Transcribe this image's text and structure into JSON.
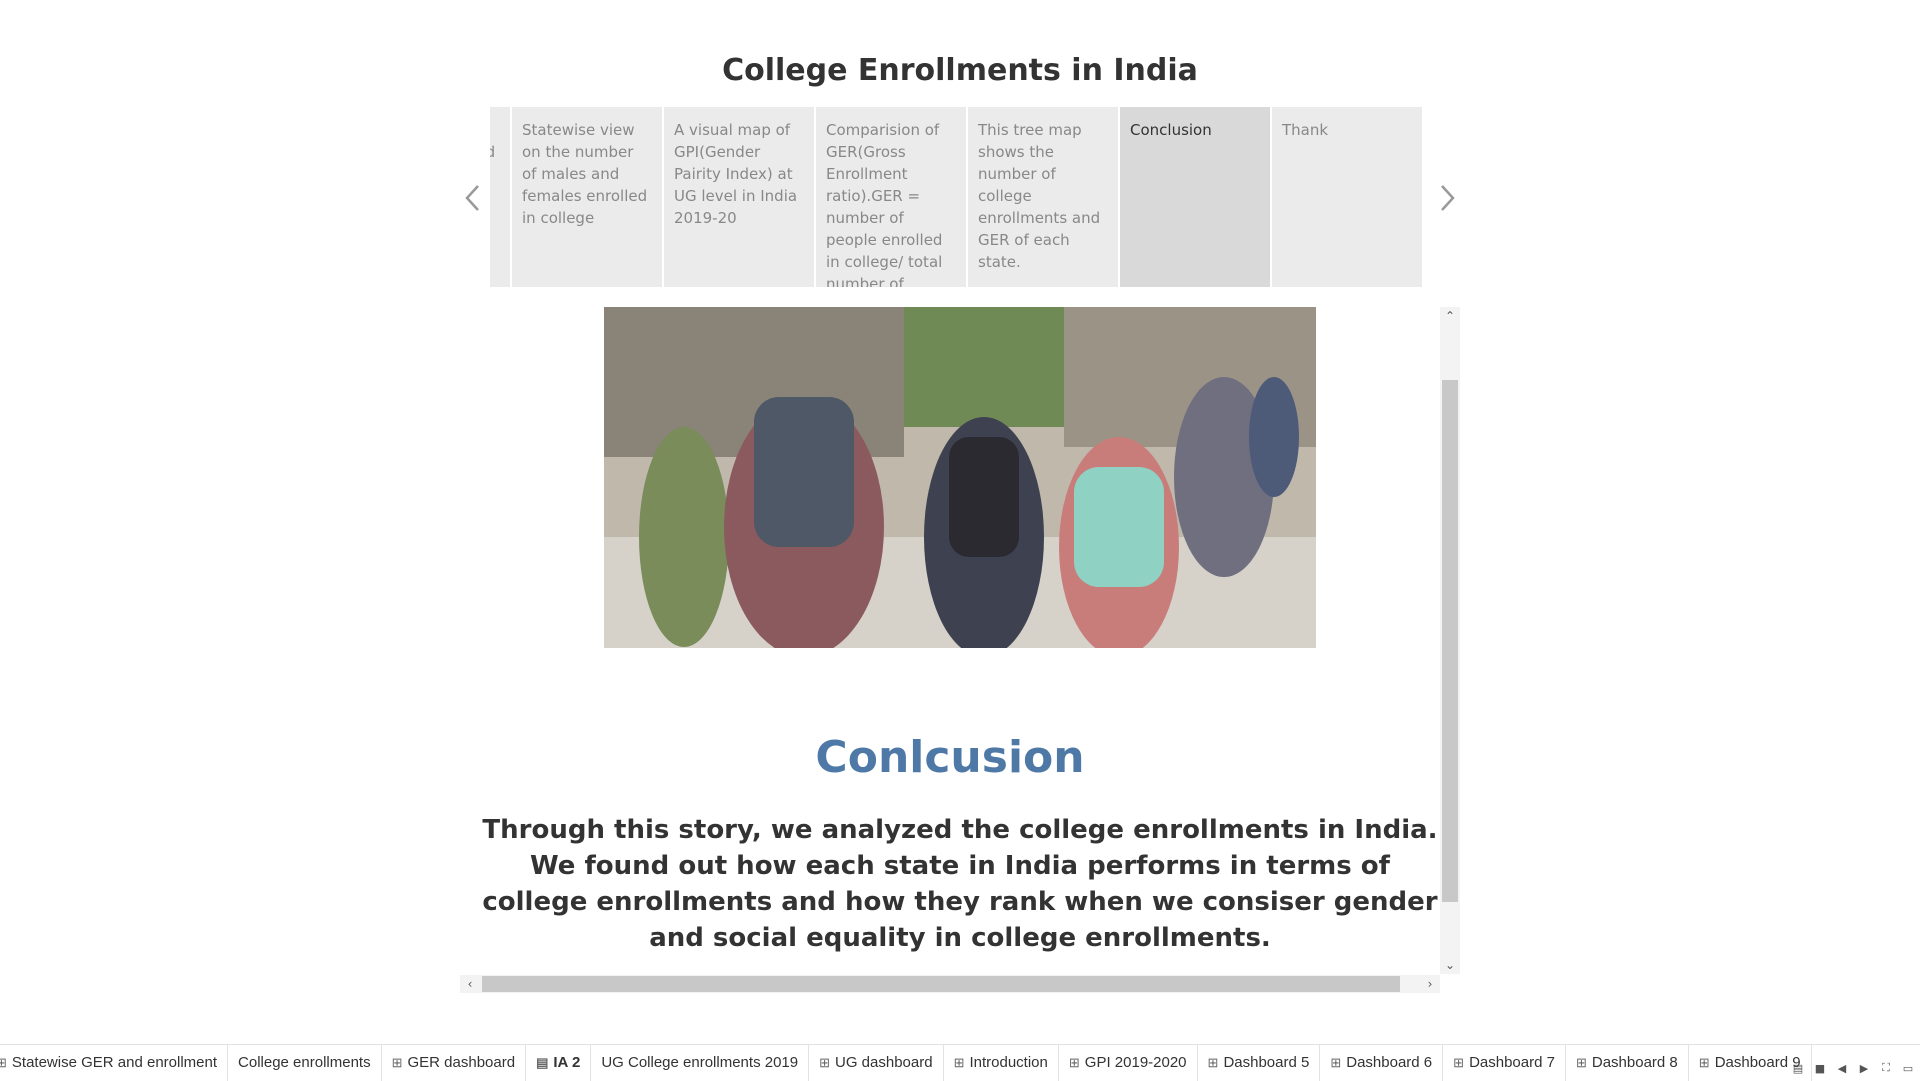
{
  "story": {
    "title": "College Enrollments in India"
  },
  "navigator": {
    "points": [
      {
        "label": "The number of females enrolled in college have surpassed the number of males.",
        "active": false
      },
      {
        "label": "Statewise view on the number of males and females enrolled in college",
        "active": false
      },
      {
        "label": "A visual map of GPI(Gender Pairity Index) at UG level in India 2019-20",
        "active": false
      },
      {
        "label": "Comparision of GER(Gross Enrollment ratio).GER = number of people enrolled in college/ total number of",
        "active": false
      },
      {
        "label": "This tree map shows the number of college enrollments and GER of each state.",
        "active": false
      },
      {
        "label": "Conclusion",
        "active": true
      },
      {
        "label": "Thank",
        "active": false
      }
    ]
  },
  "content": {
    "heading": "Conlcusion",
    "body": "Through this story, we analyzed the college enrollments in India. We found out how each state in India performs in terms of college enrollments and how they rank when we consiser gender and social equality in college enrollments."
  },
  "tabs": [
    {
      "label": "Statewise GER and enrollment",
      "icon": "dashboard-icon",
      "active": false
    },
    {
      "label": "College enrollments",
      "icon": "",
      "active": false
    },
    {
      "label": "GER dashboard",
      "icon": "dashboard-icon",
      "active": false
    },
    {
      "label": "IA 2",
      "icon": "story-icon",
      "active": true
    },
    {
      "label": "UG College enrollments 2019",
      "icon": "",
      "active": false
    },
    {
      "label": "UG dashboard",
      "icon": "dashboard-icon",
      "active": false
    },
    {
      "label": "Introduction",
      "icon": "dashboard-icon",
      "active": false
    },
    {
      "label": "GPI 2019-2020",
      "icon": "dashboard-icon",
      "active": false
    },
    {
      "label": "Dashboard 5",
      "icon": "dashboard-icon",
      "active": false
    },
    {
      "label": "Dashboard 6",
      "icon": "dashboard-icon",
      "active": false
    },
    {
      "label": "Dashboard 7",
      "icon": "dashboard-icon",
      "active": false
    },
    {
      "label": "Dashboard 8",
      "icon": "dashboard-icon",
      "active": false
    },
    {
      "label": "Dashboard 9",
      "icon": "dashboard-icon",
      "active": false
    }
  ],
  "colors": {
    "accent": "#4e79a7",
    "active_point": "#d9d9d9",
    "point_bg": "#ebebeb"
  }
}
